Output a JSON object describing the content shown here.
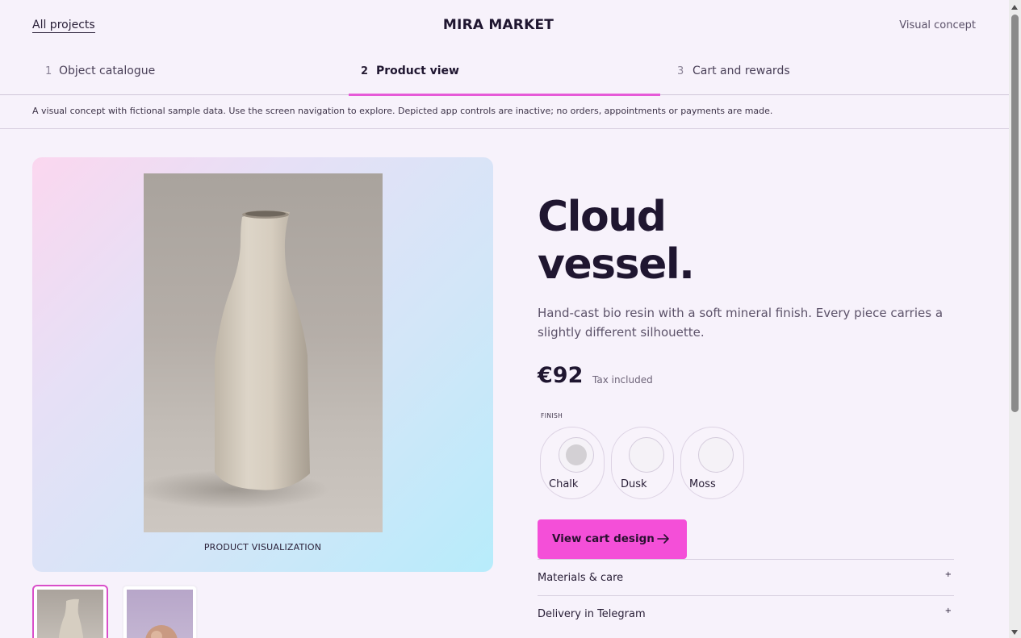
{
  "header": {
    "all_projects": "All projects",
    "brand": "MIRA MARKET",
    "concept": "Visual concept"
  },
  "steps": [
    {
      "num": "1",
      "label": "Object catalogue",
      "active": false
    },
    {
      "num": "2",
      "label": "Product view",
      "active": true
    },
    {
      "num": "3",
      "label": "Cart and rewards",
      "active": false
    }
  ],
  "notice": "A visual concept with fictional sample data. Use the screen navigation to explore. Depicted app controls are inactive; no orders, appointments or payments are made.",
  "media": {
    "caption": "PRODUCT VISUALIZATION"
  },
  "product": {
    "title": "Cloud\nvessel.",
    "description": "Hand-cast bio resin with a soft mineral finish. Every piece carries a slightly different silhouette.",
    "price": "€92",
    "tax_note": "Tax included",
    "finish_label": "FINISH",
    "finishes": [
      {
        "name": "Chalk",
        "selected": true
      },
      {
        "name": "Dusk",
        "selected": false
      },
      {
        "name": "Moss",
        "selected": false
      }
    ],
    "cta_label": "View cart design",
    "accordions": [
      {
        "label": "Materials & care",
        "icon": "+"
      },
      {
        "label": "Delivery in Telegram",
        "icon": "+"
      }
    ]
  },
  "colors": {
    "accent": "#f44fd8",
    "tab_underline": "#e65ad8",
    "background": "#f7f2fb",
    "text_dark": "#1f1630"
  }
}
